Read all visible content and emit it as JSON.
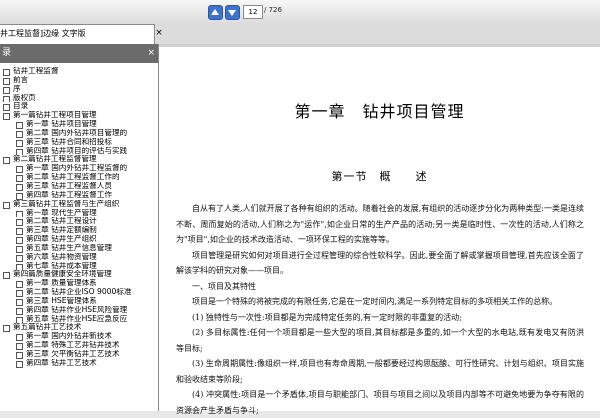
{
  "toolbar": {
    "page_current": "12",
    "page_total": "/ 726"
  },
  "tab": {
    "title": "井工程监督]边缘 文字版",
    "close": "×"
  },
  "sidebar": {
    "header": "录",
    "close": "×",
    "items": [
      {
        "label": "钻井工程监督",
        "level": 0
      },
      {
        "label": "前言",
        "level": 0
      },
      {
        "label": "序",
        "level": 0
      },
      {
        "label": "版权页",
        "level": 0
      },
      {
        "label": "目录",
        "level": 0
      },
      {
        "label": "第一篇钻井工程项目管理",
        "level": 0
      },
      {
        "label": "第一章 钻井项目管理",
        "level": 1
      },
      {
        "label": "第二章 国内外钻井项目管理的",
        "level": 1
      },
      {
        "label": "第三章 钻井合同和招投标",
        "level": 1
      },
      {
        "label": "第四章 钻井项目的评估与实践",
        "level": 1
      },
      {
        "label": "第二篇钻井工程监督管理",
        "level": 0
      },
      {
        "label": "第一章 国内外钻井工程监督的",
        "level": 1
      },
      {
        "label": "第二章 钻井工程监督工作的",
        "level": 1
      },
      {
        "label": "第三章 钻井工程监督人员",
        "level": 1
      },
      {
        "label": "第四章 钻井工程监督工作",
        "level": 1
      },
      {
        "label": "第三篇钻井工程监督与生产组织",
        "level": 0
      },
      {
        "label": "第一章 现代生产管理",
        "level": 1
      },
      {
        "label": "第二章 钻井工程设计",
        "level": 1
      },
      {
        "label": "第三章 钻井定额编制",
        "level": 1
      },
      {
        "label": "第四章 钻井生产组织",
        "level": 1
      },
      {
        "label": "第五章 钻井生产信息管理",
        "level": 1
      },
      {
        "label": "第六章 钻井物资管理",
        "level": 1
      },
      {
        "label": "第七章 钻井成本管理",
        "level": 1
      },
      {
        "label": "第四篇质量健康安全环境管理",
        "level": 0
      },
      {
        "label": "第一章 质量管理体系",
        "level": 1
      },
      {
        "label": "第二章 钻井企业ISO 9000标准",
        "level": 1
      },
      {
        "label": "第三章 HSE管理体系",
        "level": 1
      },
      {
        "label": "第四章 钻井作业HSE风险管理",
        "level": 1
      },
      {
        "label": "第五章 钻井作业HSE应急反应",
        "level": 1
      },
      {
        "label": "第五篇钻井工艺技术",
        "level": 0
      },
      {
        "label": "第一章 国内外钻井新技术",
        "level": 1
      },
      {
        "label": "第二章 特殊工艺井钻井技术",
        "level": 1
      },
      {
        "label": "第三章 欠平衡钻井工艺技术",
        "level": 1
      },
      {
        "label": "第四章 钻井工艺技术",
        "level": 1
      }
    ]
  },
  "document": {
    "chapter_title": "第一章　钻井项目管理",
    "section_title": "第一节　概　　述",
    "paragraphs": [
      "自从有了人类,人们就开展了各种有组织的活动。随着社会的发展,有组织的活动逐步分化为两种类型:一类是连续不断、周而复始的活动,人们称之为\"运作\",如企业日常的生产产品的活动;另一类是临时性、一次性的活动,人们称之为\"项目\",如企业的技术改造活动、一项环保工程的实施等等。",
      "项目管理是研究如何对项目进行全过程管理的综合性软科学。因此,要全面了解或掌握项目管理,首先应该全面了解该学科的研究对象——项目。",
      "一、项目及其特性",
      "项目是一个特殊的将被完成的有限任务,它是在一定时间内,满足一系列特定目标的多项相关工作的总称。",
      "(1) 独特性与一次性:项目都是为完成特定任务的,有一定时限的非重复的活动;",
      "(2) 多目标属性:任何一个项目都是一些大型的项目,其目标都是多重的,如一个大型的水电站,既有发电又有防洪等目标;",
      "(3) 生命周期属性:像组织一样,项目也有寿命周期,一般都要经过构思酝酿、可行性研究、计划与组织、项目实施和验收结束等阶段;",
      "(4) 冲突属性:项目是一个矛盾体,项目与职能部门、项目与项目之间以及项目内部等不可避免地要为争夺有限的资源会产生矛盾与争斗;"
    ]
  }
}
